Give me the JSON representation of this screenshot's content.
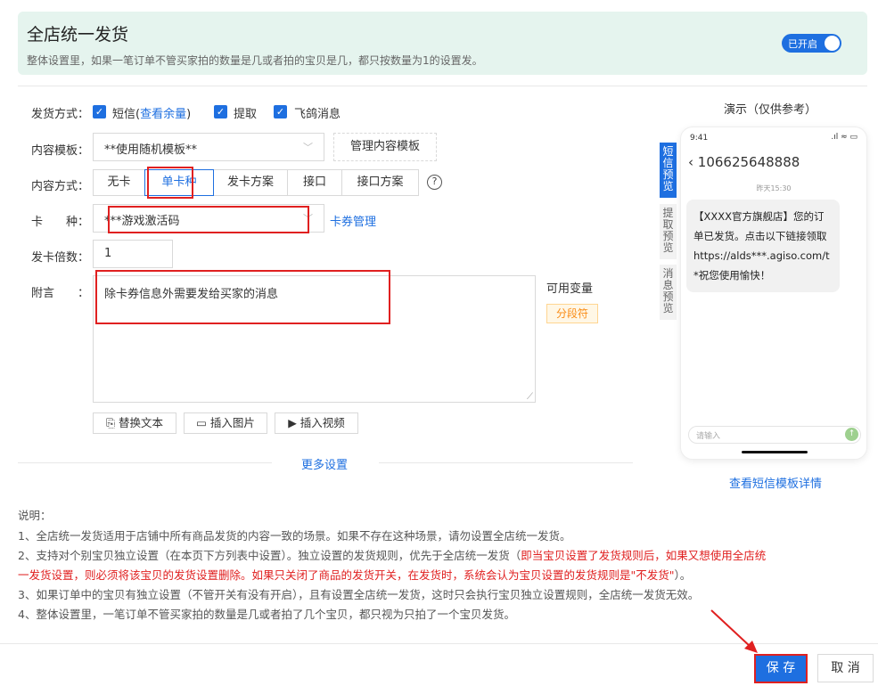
{
  "banner": {
    "title": "全店统一发货",
    "subtitle": "整体设置里，如果一笔订单不管买家拍的数量是几或者拍的宝贝是几，都只按数量为1的设置发。",
    "toggle_label": "已开启"
  },
  "form": {
    "delivery_label": "发货方式：",
    "sms_label": "短信",
    "sms_open": "(",
    "check_balance": "查看余量",
    "sms_close": ")",
    "pickup_label": "提取",
    "feige_label": "飞鸽消息",
    "template_label": "内容模板：",
    "template_value": "**使用随机模板**",
    "manage_template": "管理内容模板",
    "content_mode_label": "内容方式：",
    "modes": [
      "无卡",
      "单卡种",
      "发卡方案",
      "接口",
      "接口方案"
    ],
    "help_glyph": "?",
    "card_type_label": "卡　　种：",
    "card_type_value": "***游戏激活码",
    "card_manage": "卡券管理",
    "multiple_label": "发卡倍数：",
    "multiple_value": "1",
    "note_label": "附言　　：",
    "note_value": "除卡券信息外需要发给买家的消息",
    "variables_label": "可用变量",
    "separator_tag": "分段符",
    "replace_text": "替换文本",
    "insert_image": "插入图片",
    "insert_video": "插入视频",
    "more_settings": "更多设置"
  },
  "preview": {
    "title": "演示（仅供参考）",
    "tabs": [
      "短信预览",
      "提取预览",
      "消息预览"
    ],
    "time": "9:41",
    "status_icons": ".ıl ≈ ▭",
    "sender": "106625648888",
    "date": "昨天15:30",
    "message": "【XXXX官方旗舰店】您的订单已发货。点击以下链接领取https://alds***.agiso.com/t*祝您使用愉快！",
    "input_placeholder": "请输入",
    "view_detail": "查看短信模板详情"
  },
  "notes": {
    "heading": "说明：",
    "l1": "1、全店统一发货适用于店铺中所有商品发货的内容一致的场景。如果不存在这种场景，请勿设置全店统一发货。",
    "l2a": "2、支持对个别宝贝独立设置（在本页下方列表中设置）。独立设置的发货规则，优先于全店统一发货（",
    "l2b": "即当宝贝设置了发货规则后，如果又想使用全店统",
    "l2c": "一发货设置，则必须将该宝贝的发货设置删除。如果只关闭了商品的发货开关，在发货时，系统会认为宝贝设置的发货规则是\"不发货\"",
    "l2d": "）。",
    "l3": "3、如果订单中的宝贝有独立设置（不管开关有没有开启），且有设置全店统一发货，这时只会执行宝贝独立设置规则，全店统一发货无效。",
    "l4": "4、整体设置里，一笔订单不管买家拍的数量是几或者拍了几个宝贝，都只视为只拍了一个宝贝发货。"
  },
  "footer": {
    "save": "保 存",
    "cancel": "取 消"
  },
  "colors": {
    "primary": "#1e6fe0",
    "red": "#e02020",
    "banner_bg": "#e5f4ee"
  }
}
